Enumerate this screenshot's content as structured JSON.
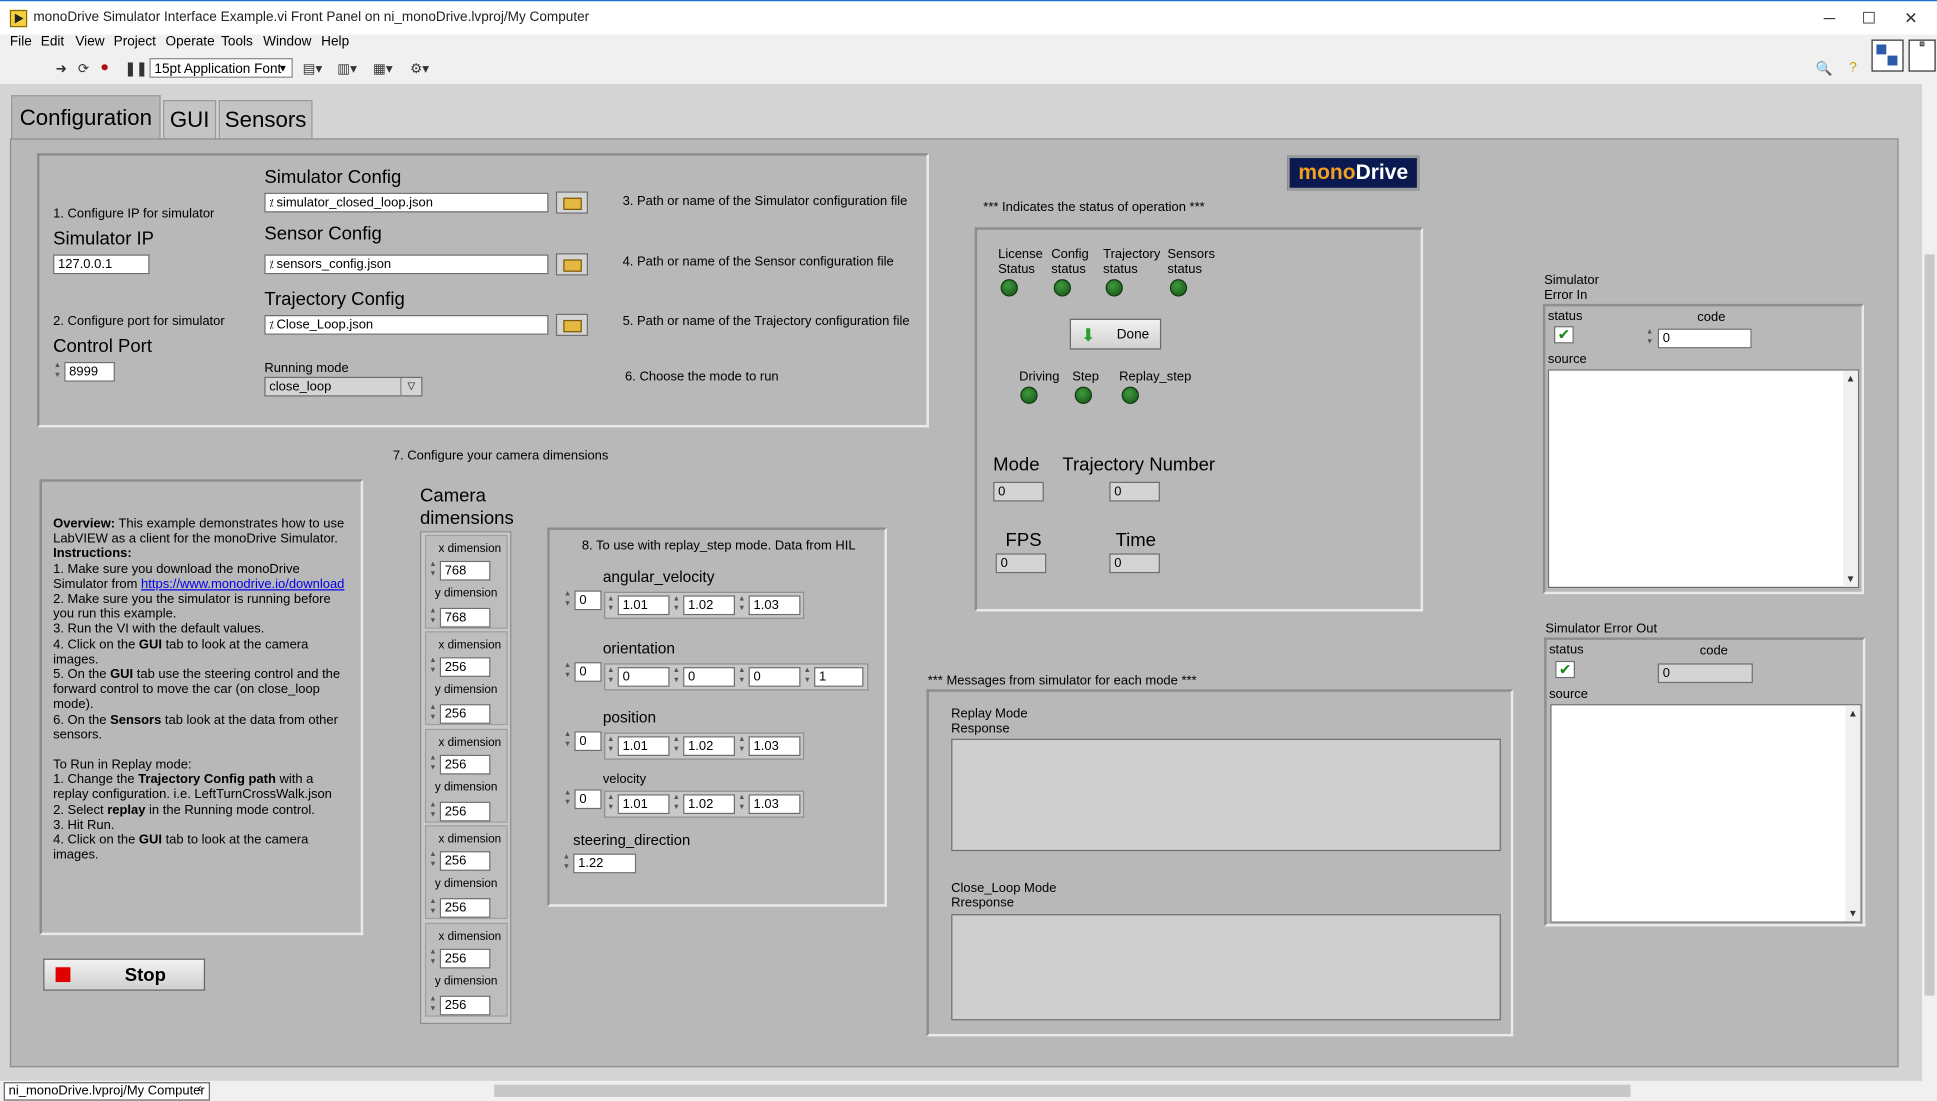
{
  "window": {
    "title": "monoDrive Simulator Interface Example.vi Front Panel on ni_monoDrive.lvproj/My Computer",
    "minimize": "─",
    "maximize": "☐",
    "close": "✕"
  },
  "menu": [
    "File",
    "Edit",
    "View",
    "Project",
    "Operate",
    "Tools",
    "Window",
    "Help"
  ],
  "toolbar": {
    "font": "15pt Application Font"
  },
  "tabs": [
    "Configuration",
    "GUI",
    "Sensors"
  ],
  "config": {
    "step1": "1. Configure IP for simulator",
    "sim_ip_label": "Simulator IP",
    "sim_ip": "127.0.0.1",
    "step2": "2. Configure port for simulator",
    "port_label": "Control Port",
    "port": "8999",
    "sim_config_label": "Simulator Config",
    "sim_config": "simulator_closed_loop.json",
    "sensor_config_label": "Sensor Config",
    "sensor_config": "sensors_config.json",
    "traj_config_label": "Trajectory Config",
    "traj_config": "Close_Loop.json",
    "running_mode_label": "Running mode",
    "running_mode": "close_loop",
    "step3": "3. Path or name of the Simulator configuration file",
    "step4": "4. Path or name of the Sensor configuration file",
    "step5": "5. Path or name of the Trajectory configuration file",
    "step6": "6. Choose the mode to run"
  },
  "logo": "monoDrive",
  "status": {
    "header": "*** Indicates the status of operation ***",
    "license": "License Status",
    "config": "Config status",
    "trajectory": "Trajectory status",
    "sensors": "Sensors status",
    "done": "Done",
    "driving": "Driving",
    "step": "Step",
    "replay_step": "Replay_step",
    "mode_label": "Mode",
    "mode": "0",
    "traj_num_label": "Trajectory Number",
    "traj_num": "0",
    "fps_label": "FPS",
    "fps": "0",
    "time_label": "Time",
    "time": "0"
  },
  "overview": {
    "title": "Overview:",
    "intro": " This example demonstrates how to use LabVIEW as a client for the monoDrive Simulator.",
    "instr_title": "Instructions:",
    "i1a": "1. Make sure you download the monoDrive Simulator from ",
    "link": "https://www.monodrive.io/download",
    "i2": "2. Make sure you the simulator is running before you run this example.",
    "i3": "3. Run the VI with the default values.",
    "i4a": "4. Click on the ",
    "i4b": "GUI",
    "i4c": " tab to look at the camera images.",
    "i5a": "5. On the ",
    "i5b": "GUI",
    "i5c": " tab use the steering control and the forward control to move the car (on close_loop mode).",
    "i6a": "6. On the ",
    "i6b": "Sensors",
    "i6c": " tab look at the data from other sensors.",
    "replay_title": "To Run in Replay mode:",
    "r1a": "1. Change the ",
    "r1b": "Trajectory Config path",
    "r1c": " with a replay configuration. i.e. LeftTurnCrossWalk.json",
    "r2a": "2. Select ",
    "r2b": "replay",
    "r2c": " in the Running mode control.",
    "r3": "3. Hit Run.",
    "r4a": "4. Click on the ",
    "r4b": "GUI",
    "r4c": " tab to look at the camera images."
  },
  "stop_label": "Stop",
  "camera": {
    "step7": "7. Configure your camera dimensions",
    "title": "Camera dimensions",
    "x_label": "x dimension",
    "y_label": "y dimension",
    "dims": [
      {
        "x": "768",
        "y": "768"
      },
      {
        "x": "256",
        "y": "256"
      },
      {
        "x": "256",
        "y": "256"
      },
      {
        "x": "256",
        "y": "256"
      },
      {
        "x": "256",
        "y": "256"
      }
    ]
  },
  "hil": {
    "step8": "8. To use with replay_step mode. Data from HIL",
    "angular_velocity_label": "angular_velocity",
    "angular_velocity_index": "0",
    "angular_velocity": [
      "1.01",
      "1.02",
      "1.03"
    ],
    "orientation_label": "orientation",
    "orientation_index": "0",
    "orientation": [
      "0",
      "0",
      "0",
      "1"
    ],
    "position_label": "position",
    "position_index": "0",
    "position": [
      "1.01",
      "1.02",
      "1.03"
    ],
    "velocity_label": "velocity",
    "velocity_index": "0",
    "velocity": [
      "1.01",
      "1.02",
      "1.03"
    ],
    "steering_label": "steering_direction",
    "steering": "1.22"
  },
  "messages": {
    "header": "*** Messages from simulator for each mode ***",
    "replay_label": "Replay Mode\nResponse",
    "close_label": "Close_Loop Mode\nRresponse"
  },
  "error_in": {
    "title": "Simulator\nError In",
    "status_label": "status",
    "code_label": "code",
    "code": "0",
    "source_label": "source"
  },
  "error_out": {
    "title": "Simulator Error Out",
    "status_label": "status",
    "code_label": "code",
    "code": "0",
    "source_label": "source"
  },
  "statusbar": {
    "path": "ni_monoDrive.lvproj/My Computer"
  }
}
